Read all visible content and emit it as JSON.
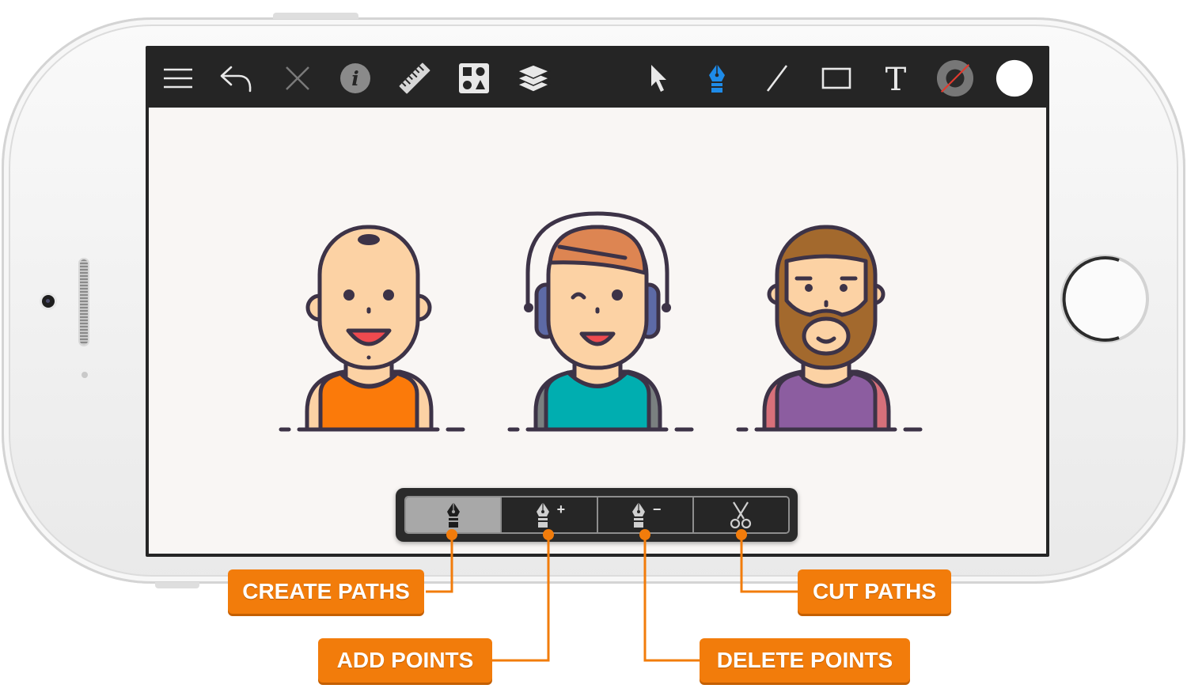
{
  "toolbar": {
    "tools": [
      "menu-icon",
      "undo-icon",
      "close-icon",
      "info-icon",
      "ruler-icon",
      "shapes-library-icon",
      "layers-icon",
      "select-arrow-icon",
      "pen-tool-icon",
      "line-tool-icon",
      "rectangle-tool-icon",
      "text-tool-icon",
      "stroke-color-icon",
      "fill-color-icon"
    ],
    "info_glyph": "i",
    "text_glyph": "T",
    "active_tool": "pen-tool-icon",
    "accent_color": "#1e8be8",
    "fill_color": "#ffffff"
  },
  "pen_modes": {
    "items": [
      {
        "name": "create-paths",
        "icon": "pen-nib-icon",
        "suffix": ""
      },
      {
        "name": "add-points",
        "icon": "pen-nib-plus-icon",
        "suffix": "+"
      },
      {
        "name": "delete-points",
        "icon": "pen-nib-minus-icon",
        "suffix": "−"
      },
      {
        "name": "cut-paths",
        "icon": "scissors-icon",
        "suffix": ""
      }
    ],
    "active": "create-paths"
  },
  "callouts": {
    "create_paths": "CREATE PATHS",
    "add_points": "ADD POINTS",
    "delete_points": "DELETE POINTS",
    "cut_paths": "CUT PATHS"
  },
  "colors": {
    "callout": "#f27c0b",
    "canvas": "#f9f6f4",
    "outline": "#3d3347",
    "skin": "#fcd2a4",
    "orange_shirt": "#fb7a0a",
    "teal_shirt": "#00aeb0",
    "purple_shirt": "#8c5da0",
    "headphones": "#5d6aa6",
    "beard": "#a3692d"
  }
}
